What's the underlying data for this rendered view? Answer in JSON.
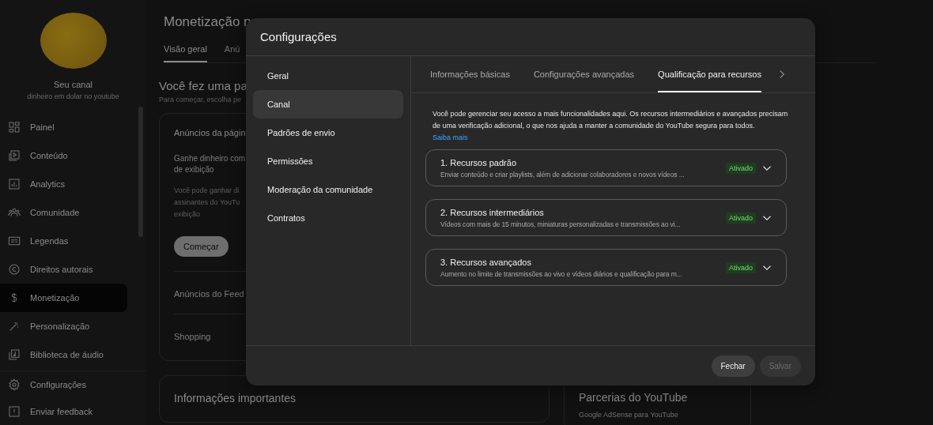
{
  "sidebar": {
    "channel_label": "Seu canal",
    "channel_name": "dinheiro em dolar no youtube",
    "items": [
      {
        "label": "Painel",
        "selected": false
      },
      {
        "label": "Conteúdo",
        "selected": false
      },
      {
        "label": "Analytics",
        "selected": false
      },
      {
        "label": "Comunidade",
        "selected": false
      },
      {
        "label": "Legendas",
        "selected": false
      },
      {
        "label": "Direitos autorais",
        "selected": false
      },
      {
        "label": "Monetização",
        "selected": true
      },
      {
        "label": "Personalização",
        "selected": false
      },
      {
        "label": "Biblioteca de áudio",
        "selected": false
      }
    ],
    "footer_items": [
      {
        "label": "Configurações"
      },
      {
        "label": "Enviar feedback"
      }
    ]
  },
  "page": {
    "title": "Monetização n",
    "tabs": [
      {
        "label": "Visão geral",
        "selected": true
      },
      {
        "label": "Anú",
        "selected": false
      }
    ],
    "heading": "Você fez uma pa",
    "subheading": "Para começar, escolha pe",
    "card": {
      "title": "Anúncios da págin",
      "lead_lines": [
        "Ganhe dinheiro com",
        "de exibição"
      ],
      "body_lines": [
        "Você pode ganhar di",
        "assinantes do YouTu",
        "exibição"
      ],
      "button": "Começar",
      "rows": [
        "Anúncios do Feed",
        "Shopping"
      ]
    },
    "info_card": {
      "title": "Informações importantes"
    },
    "partner_card": {
      "title": "Parcerias do YouTube",
      "subtitle": "Google AdSense para YouTube"
    }
  },
  "dialog": {
    "title": "Configurações",
    "nav": [
      {
        "label": "Geral",
        "selected": false
      },
      {
        "label": "Canal",
        "selected": true
      },
      {
        "label": "Padrões de envio",
        "selected": false
      },
      {
        "label": "Permissões",
        "selected": false
      },
      {
        "label": "Moderação da comunidade",
        "selected": false
      },
      {
        "label": "Contratos",
        "selected": false
      }
    ],
    "tabs": [
      {
        "label": "Informações básicas",
        "selected": false
      },
      {
        "label": "Configurações avançadas",
        "selected": false
      },
      {
        "label": "Qualificação para recursos",
        "selected": true
      }
    ],
    "intro": "Você pode gerenciar seu acesso a mais funcionalidades aqui. Os recursos intermediários e avançados precisam de uma verificação adicional, o que nos ajuda a manter a comunidade do YouTube segura para todos.",
    "intro_link": "Saiba mais",
    "features": [
      {
        "title": "1. Recursos padrão",
        "description": "Enviar conteúdo e criar playlists, além de adicionar colaboradores e novos vídeos ...",
        "status": "Ativado",
        "expanded": false
      },
      {
        "title": "2. Recursos intermediários",
        "description": "Vídeos com mais de 15 minutos, miniaturas personalizadas e transmissões ao vi...",
        "status": "Ativado",
        "expanded": false
      },
      {
        "title": "3. Recursos avançados",
        "description": "Aumento no limite de transmissões ao vivo e vídeos diários e qualificação para m...",
        "status": "Ativado",
        "expanded": false
      }
    ],
    "buttons": [
      {
        "label": "Fechar",
        "disabled": false
      },
      {
        "label": "Salvar",
        "disabled": true
      }
    ]
  }
}
